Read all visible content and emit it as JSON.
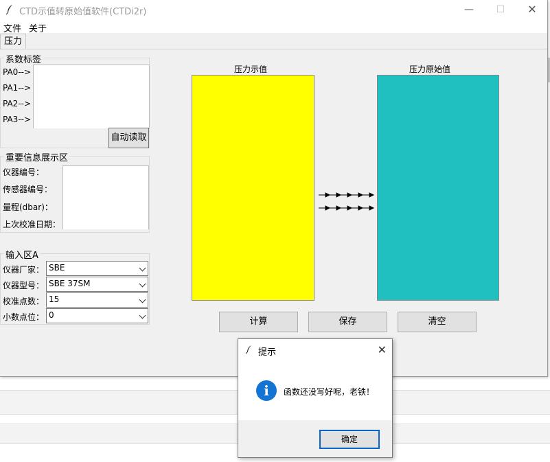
{
  "window": {
    "title": "CTD示值转原始值软件(CTDi2r)"
  },
  "menu": {
    "file": "文件",
    "about": "关于"
  },
  "tabs": [
    {
      "label": "压力"
    }
  ],
  "coef_group": {
    "title": "系数标签",
    "labels": [
      "PA0-->",
      "PA1-->",
      "PA2-->",
      "PA3-->"
    ],
    "auto_read_button": "自动读取"
  },
  "info_group": {
    "title": "重要信息展示区",
    "labels": [
      "仪器编号：",
      "传感器编号：",
      "量程(dbar)：",
      "上次校准日期："
    ]
  },
  "input_group": {
    "title": "输入区A",
    "fields": [
      {
        "label": "仪器厂家：",
        "value": "SBE"
      },
      {
        "label": "仪器型号：",
        "value": "SBE 37SM"
      },
      {
        "label": "校准点数：",
        "value": "15"
      },
      {
        "label": "小数点位：",
        "value": "0"
      }
    ]
  },
  "display": {
    "left_title": "压力示值",
    "right_title": "压力原始值",
    "left_color": "#ffff00",
    "right_color": "#20c0c0"
  },
  "actions": {
    "compute": "计算",
    "save": "保存",
    "clear": "清空"
  },
  "dialog": {
    "title": "提示",
    "message": "函数还没写好呢，老铁！",
    "ok": "确定",
    "icon": "info-icon"
  }
}
